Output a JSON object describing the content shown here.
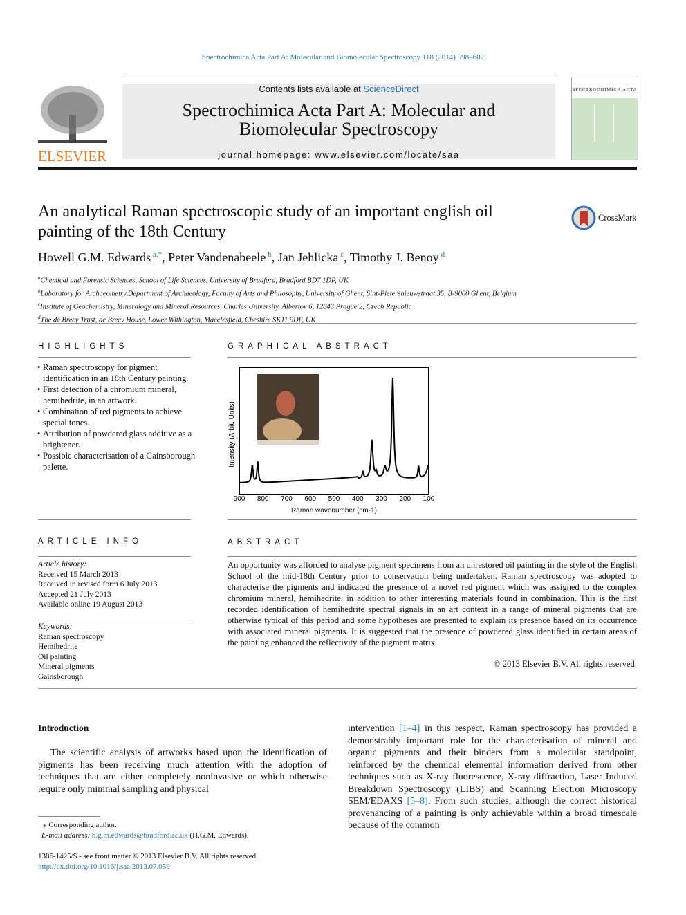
{
  "citation": "Spectrochimica Acta Part A: Molecular and Biomolecular Spectroscopy 118 (2014) 598–602",
  "publisher": "ELSEVIER",
  "header": {
    "contents_prefix": "Contents lists available at ",
    "contents_link": "ScienceDirect",
    "journal_title": "Spectrochimica Acta Part A: Molecular and Biomolecular Spectroscopy",
    "homepage": "journal homepage: www.elsevier.com/locate/saa",
    "cover_text": "SPECTROCHIMICA ACTA"
  },
  "crossmark": "CrossMark",
  "title": "An analytical Raman spectroscopic study of an important english oil painting of the 18th Century",
  "authors": [
    {
      "name": "Howell G.M. Edwards",
      "sup": "a,*"
    },
    {
      "name": "Peter Vandenabeele",
      "sup": "b"
    },
    {
      "name": "Jan Jehlicka",
      "sup": "c"
    },
    {
      "name": "Timothy J. Benoy",
      "sup": "d"
    }
  ],
  "affiliations": [
    {
      "sup": "a",
      "text": "Chemical and Forensic Sciences, School of Life Sciences, University of Bradford, Bradford BD7 1DP, UK"
    },
    {
      "sup": "b",
      "text": "Laboratory for Archaeometry,Department of Archaeology, Faculty of Arts and Philosophy, University of Ghent, Sint-Pietersnieuwstraat 35, B-9000 Ghent, Belgium"
    },
    {
      "sup": "c",
      "text": "Institute of Geochemistry, Mineralogy and Mineral Resources, Charles University, Albertov 6, 12843 Prague 2, Czech Republic"
    },
    {
      "sup": "d",
      "text": "The de Brecy Trust, de Brecy House, Lower Withington, Macclesfield, Cheshire SK11 9DF, UK"
    }
  ],
  "highlights": {
    "heading": "HIGHLIGHTS",
    "items": [
      "Raman spectroscopy for pigment identification in an 18th Century painting.",
      "First detection of a chromium mineral, hemihedrite, in an artwork.",
      "Combination of red pigments to achieve special tones.",
      "Attribution of powdered glass additive as a brightener.",
      "Possible characterisation of a Gainsborough palette."
    ]
  },
  "graphical_abstract": {
    "heading": "GRAPHICAL ABSTRACT",
    "ylabel": "Intensity (Arbit. Units)",
    "xlabel": "Raman wavenumber (cm-1)",
    "xticks": [
      "900",
      "800",
      "700",
      "600",
      "500",
      "400",
      "300",
      "200",
      "100"
    ]
  },
  "article_info": {
    "heading": "ARTICLE INFO",
    "history_label": "Article history:",
    "history": [
      "Received 15 March 2013",
      "Received in revised form 6 July 2013",
      "Accepted 21 July 2013",
      "Available online 19 August 2013"
    ],
    "keywords_label": "Keywords:",
    "keywords": [
      "Raman spectroscopy",
      "Hemihedrite",
      "Oil painting",
      "Mineral pigments",
      "Gainsborough"
    ]
  },
  "abstract": {
    "heading": "ABSTRACT",
    "text": "An opportunity was afforded to analyse pigment specimens from an unrestored oil painting in the style of the English School of the mid-18th Century prior to conservation being undertaken. Raman spectroscopy was adopted to characterise the pigments and indicated the presence of a novel red pigment which was assigned to the complex chromium mineral, hemihedrite, in addition to other interesting materials found in combination. This is the first recorded identification of hemihedrite spectral signals in an art context in a range of mineral pigments that are otherwise typical of this period and some hypotheses are presented to explain its presence based on its occurrence with associated mineral pigments. It is suggested that the presence of powdered glass identified in certain areas of the painting enhanced the reflectivity of the pigment matrix.",
    "copyright": "© 2013 Elsevier B.V. All rights reserved."
  },
  "intro": {
    "heading": "Introduction",
    "p1": "The scientific analysis of artworks based upon the identification of pigments has been receiving much attention with the adoption of techniques that are either completely noninvasive or which otherwise require only minimal sampling and physical",
    "p2a": "intervention ",
    "ref1": "[1–4]",
    "p2b": " in this respect, Raman spectroscopy has provided a demonstrably important role for the characterisation of mineral and organic pigments and their binders from a molecular standpoint, reinforced by the chemical elemental information derived from other techniques such as X-ray fluorescence, X-ray diffraction, Laser Induced Breakdown Spectroscopy (LIBS) and Scanning Electron Microscopy SEM/EDAXS ",
    "ref2": "[5–8]",
    "p2c": ". From such studies, although the correct historical provenancing of a painting is only achievable within a broad timescale because of the common"
  },
  "footnote": {
    "star": "⁎ Corresponding author.",
    "email_label": "E-mail address: ",
    "email": "h.g.m.edwards@bradford.ac.uk",
    "email_suffix": " (H.G.M. Edwards)."
  },
  "footer": {
    "issn": "1386-1425/$ - see front matter © 2013 Elsevier B.V. All rights reserved.",
    "doi": "http://dx.doi.org/10.1016/j.saa.2013.07.059"
  }
}
